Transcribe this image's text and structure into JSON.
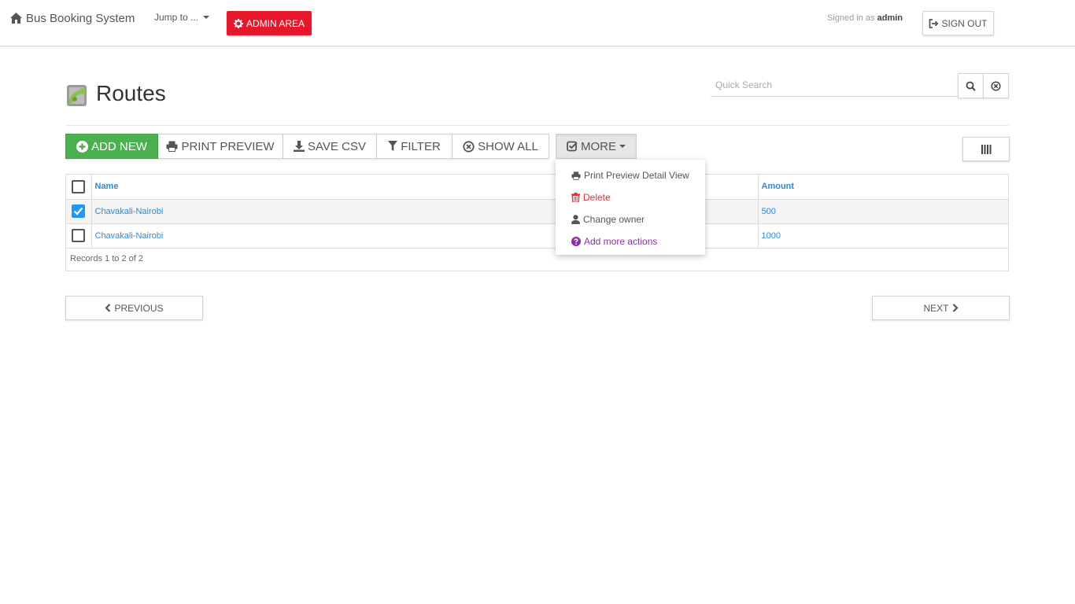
{
  "navbar": {
    "brand": "Bus Booking System",
    "jump_to": "Jump to ...",
    "admin_area": "ADMIN AREA",
    "signed_in_prefix": "Signed in as",
    "username": "admin",
    "sign_out": "SIGN OUT"
  },
  "page": {
    "title": "Routes",
    "search_placeholder": "Quick Search"
  },
  "toolbar": {
    "add_new": "ADD NEW",
    "print_preview": "PRINT PREVIEW",
    "save_csv": "SAVE CSV",
    "filter": "FILTER",
    "show_all": "SHOW ALL",
    "more": "MORE"
  },
  "table": {
    "columns": [
      "Name",
      "",
      "Amount"
    ],
    "rows": [
      {
        "name": "Chavakali-Nairobi",
        "amount": "500",
        "checked": true
      },
      {
        "name": "Chavakali-Nairobi",
        "amount": "1000",
        "checked": false
      }
    ],
    "records": "Records 1 to 2 of 2"
  },
  "more_menu": [
    {
      "label": "Print Preview Detail View",
      "icon": "print-icon"
    },
    {
      "label": "Delete",
      "icon": "trash-icon"
    },
    {
      "label": "Change owner",
      "icon": "user-icon"
    },
    {
      "label": "Add more actions",
      "icon": "question-circle-icon"
    }
  ],
  "pager": {
    "previous": "PREVIOUS",
    "next": "NEXT"
  },
  "colors": {
    "admin_red": "#e4182a",
    "add_green": "#4caf50",
    "link_blue": "#2f87d6",
    "checkbox_blue": "#2196f3",
    "danger_red": "#d9343f",
    "purple": "#8e2eaa"
  }
}
